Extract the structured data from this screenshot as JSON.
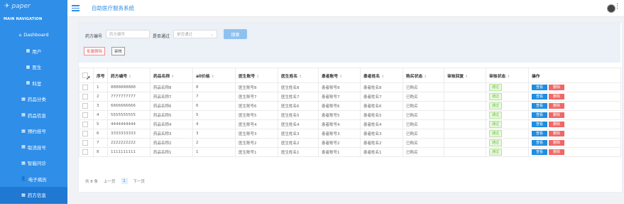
{
  "logo": {
    "text": "paper"
  },
  "sidebar": {
    "title": "MAIN NAVIGATION",
    "items": [
      {
        "label": "Dashboard",
        "icon": "home-icon"
      },
      {
        "label": "用户",
        "icon": "grid-icon"
      },
      {
        "label": "医生",
        "icon": "grid-icon"
      },
      {
        "label": "科室",
        "icon": "grid-icon"
      },
      {
        "label": "药品分类",
        "icon": "grid-icon"
      },
      {
        "label": "药品信息",
        "icon": "grid-icon"
      },
      {
        "label": "预约挂号",
        "icon": "grid-icon"
      },
      {
        "label": "取消挂号",
        "icon": "grid-icon"
      },
      {
        "label": "智能问诊",
        "icon": "grid-icon"
      },
      {
        "label": "电子病历",
        "icon": "user-icon"
      },
      {
        "label": "药方信息",
        "icon": "grid-icon"
      }
    ]
  },
  "header": {
    "title": "自助医疗服务系统"
  },
  "filter": {
    "code_label": "药方编号",
    "code_placeholder": "药方编号",
    "pass_label": "是否通过",
    "pass_placeholder": "是否通过",
    "search_label": "搜索",
    "batch_delete_label": "批量删除",
    "audit_label": "审核"
  },
  "table": {
    "columns": [
      "序号",
      "药方编号",
      "药品名称",
      "all价格",
      "医生账号",
      "医生姓名",
      "患者账号",
      "患者姓名",
      "购买状态",
      "审核回复",
      "审核状态",
      "操作"
    ],
    "rows": [
      {
        "no": "1",
        "code": "8888888888",
        "drug": "药品名称8",
        "price": "8",
        "doc_acc": "医生账号8",
        "doc_name": "医生姓名8",
        "pat_acc": "患者账号8",
        "pat_name": "患者姓名8",
        "buy": "已购买",
        "reply": "",
        "status": "通过"
      },
      {
        "no": "2",
        "code": "7777777777",
        "drug": "药品名称7",
        "price": "7",
        "doc_acc": "医生账号7",
        "doc_name": "医生姓名7",
        "pat_acc": "患者账号7",
        "pat_name": "患者姓名7",
        "buy": "已购买",
        "reply": "",
        "status": "通过"
      },
      {
        "no": "3",
        "code": "6666666666",
        "drug": "药品名称6",
        "price": "6",
        "doc_acc": "医生账号6",
        "doc_name": "医生姓名6",
        "pat_acc": "患者账号6",
        "pat_name": "患者姓名6",
        "buy": "已购买",
        "reply": "",
        "status": "通过"
      },
      {
        "no": "4",
        "code": "5555555555",
        "drug": "药品名称5",
        "price": "5",
        "doc_acc": "医生账号5",
        "doc_name": "医生姓名5",
        "pat_acc": "患者账号5",
        "pat_name": "患者姓名5",
        "buy": "已购买",
        "reply": "",
        "status": "通过"
      },
      {
        "no": "5",
        "code": "4444444444",
        "drug": "药品名称4",
        "price": "4",
        "doc_acc": "医生账号4",
        "doc_name": "医生姓名4",
        "pat_acc": "患者账号4",
        "pat_name": "患者姓名4",
        "buy": "已购买",
        "reply": "",
        "status": "通过"
      },
      {
        "no": "6",
        "code": "3333333333",
        "drug": "药品名称3",
        "price": "3",
        "doc_acc": "医生账号3",
        "doc_name": "医生姓名3",
        "pat_acc": "患者账号3",
        "pat_name": "患者姓名3",
        "buy": "已购买",
        "reply": "",
        "status": "通过"
      },
      {
        "no": "7",
        "code": "2222222222",
        "drug": "药品名称2",
        "price": "2",
        "doc_acc": "医生账号2",
        "doc_name": "医生姓名2",
        "pat_acc": "患者账号2",
        "pat_name": "患者姓名2",
        "buy": "已购买",
        "reply": "",
        "status": "通过"
      },
      {
        "no": "8",
        "code": "1111111111",
        "drug": "药品名称1",
        "price": "1",
        "doc_acc": "医生账号1",
        "doc_name": "医生姓名1",
        "pat_acc": "患者账号1",
        "pat_name": "患者姓名1",
        "buy": "已购买",
        "reply": "",
        "status": "通过"
      }
    ],
    "view_label": "查看",
    "delete_label": "删除"
  },
  "pager": {
    "total": "共 8 条",
    "prev": "上一页",
    "current": "1",
    "next": "下一页"
  },
  "colors": {
    "primary": "#2f8ee8",
    "danger": "#f06767",
    "success": "#67c23a"
  }
}
